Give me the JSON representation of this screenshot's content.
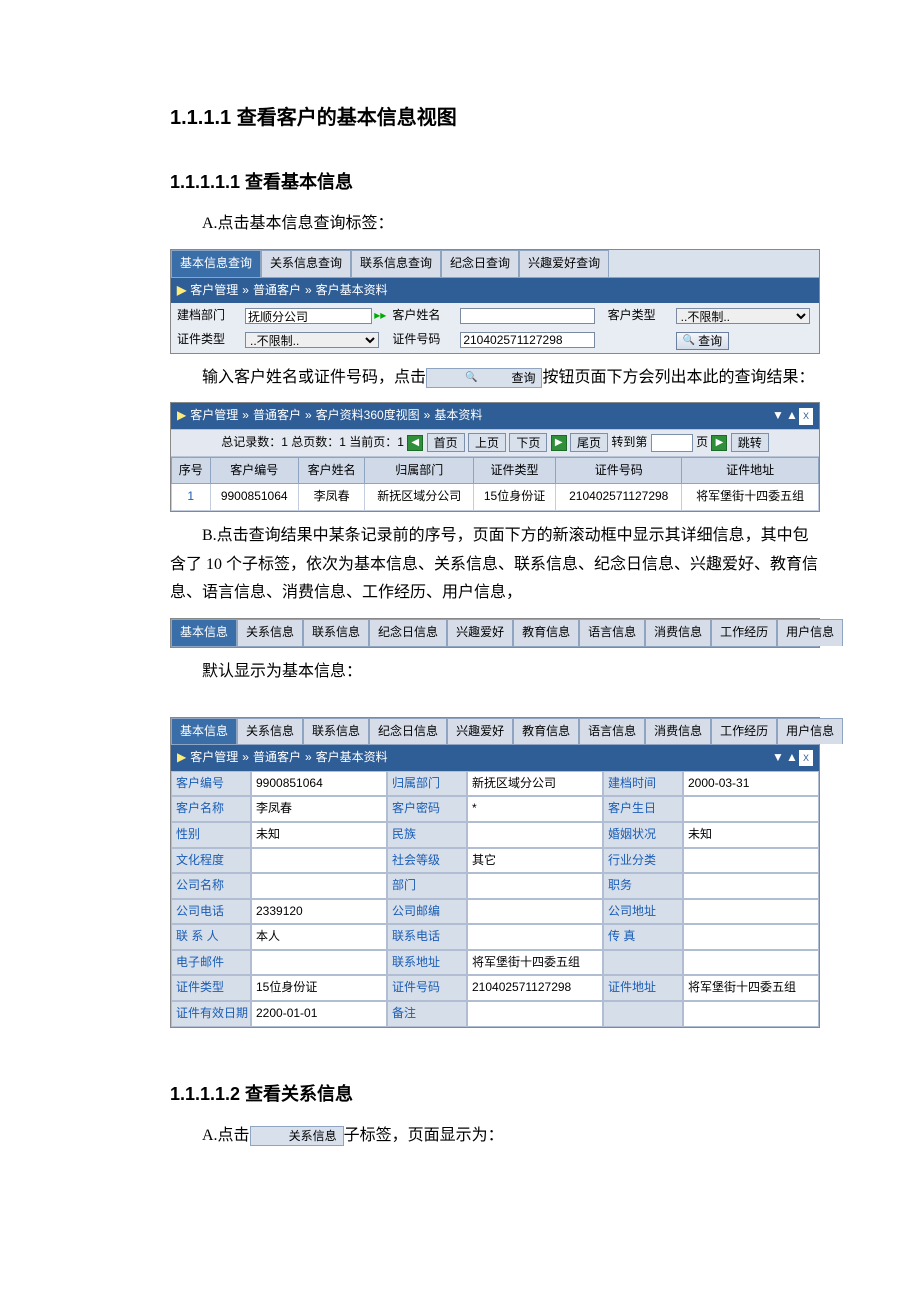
{
  "headings": {
    "h1": "1.1.1.1  查看客户的基本信息视图",
    "h2": "1.1.1.1.1  查看基本信息",
    "h3": "1.1.1.1.2  查看关系信息"
  },
  "paragraphs": {
    "p1": "A.点击基本信息查询标签：",
    "p2a": "输入客户姓名或证件号码，点击",
    "p2b": "按钮页面下方会列出本此的查询结果：",
    "p3": "B.点击查询结果中某条记录前的序号，页面下方的新滚动框中显示其详细信息，其中包含了 10 个子标签，依次为基本信息、关系信息、联系信息、纪念日信息、兴趣爱好、教育信息、语言信息、消费信息、工作经历、用户信息，",
    "p4": "默认显示为基本信息：",
    "p5a": "A.点击",
    "p5b": "子标签，页面显示为："
  },
  "inline": {
    "query": "查询",
    "relTab": "关系信息"
  },
  "tabs1": [
    "基本信息查询",
    "关系信息查询",
    "联系信息查询",
    "纪念日查询",
    "兴趣爱好查询"
  ],
  "breadcrumb1": [
    "客户管理",
    "普通客户",
    "客户基本资料"
  ],
  "filters": {
    "dept": {
      "label": "建档部门",
      "value": "抚顺分公司"
    },
    "name": {
      "label": "客户姓名",
      "value": ""
    },
    "type": {
      "label": "客户类型",
      "value": "..不限制.."
    },
    "idtype": {
      "label": "证件类型",
      "value": "..不限制.."
    },
    "idno": {
      "label": "证件号码",
      "value": "210402571127298"
    },
    "queryBtn": "查询"
  },
  "breadcrumb2": [
    "客户管理",
    "普通客户",
    "客户资料360度视图",
    "基本资料"
  ],
  "pager": {
    "total": "总记录数：1 总页数：1 当前页：1",
    "first": "首页",
    "prev": "上页",
    "next": "下页",
    "last": "尾页",
    "jumpLabel": "转到第",
    "pageSuffix": "页",
    "jumpBtn": "跳转"
  },
  "gridHeaders": [
    "序号",
    "客户编号",
    "客户姓名",
    "归属部门",
    "证件类型",
    "证件号码",
    "证件地址"
  ],
  "gridRow": [
    "1",
    "9900851064",
    "李凤春",
    "新抚区域分公司",
    "15位身份证",
    "210402571127298",
    "将军堡街十四委五组"
  ],
  "tabs2": [
    "基本信息",
    "关系信息",
    "联系信息",
    "纪念日信息",
    "兴趣爱好",
    "教育信息",
    "语言信息",
    "消费信息",
    "工作经历",
    "用户信息"
  ],
  "tabs3": [
    "基本信息",
    "关系信息",
    "联系信息",
    "纪念日信息",
    "兴趣爱好",
    "教育信息",
    "语言信息",
    "消费信息",
    "工作经历",
    "用户信息"
  ],
  "breadcrumb3": [
    "客户管理",
    "普通客户",
    "客户基本资料"
  ],
  "form": [
    [
      "客户编号",
      "9900851064",
      "归属部门",
      "新抚区域分公司",
      "建档时间",
      "2000-03-31"
    ],
    [
      "客户名称",
      "李凤春",
      "客户密码",
      "*",
      "客户生日",
      ""
    ],
    [
      "性别",
      "未知",
      "民族",
      "",
      "婚姻状况",
      "未知"
    ],
    [
      "文化程度",
      "",
      "社会等级",
      "其它",
      "行业分类",
      ""
    ],
    [
      "公司名称",
      "",
      "部门",
      "",
      "职务",
      ""
    ],
    [
      "公司电话",
      "2339120",
      "公司邮编",
      "",
      "公司地址",
      ""
    ],
    [
      "联 系 人",
      "本人",
      "联系电话",
      "",
      "传 真",
      ""
    ],
    [
      "电子邮件",
      "",
      "联系地址",
      "将军堡街十四委五组",
      "",
      ""
    ],
    [
      "证件类型",
      "15位身份证",
      "证件号码",
      "210402571127298",
      "证件地址",
      "将军堡街十四委五组"
    ],
    [
      "证件有效日期",
      "2200-01-01",
      "备注",
      "",
      "",
      ""
    ]
  ]
}
